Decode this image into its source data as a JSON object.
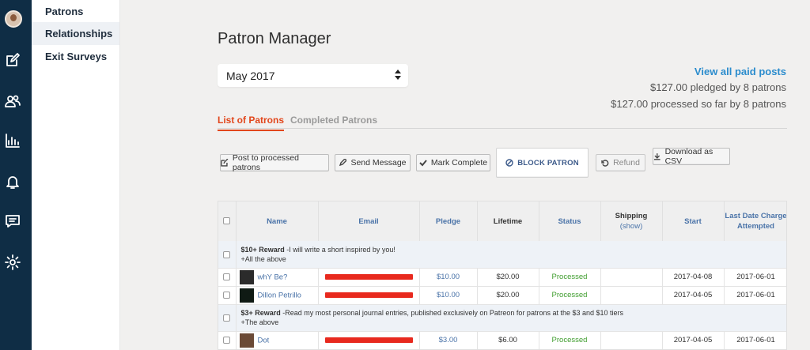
{
  "subnav": {
    "items": [
      {
        "label": "Patrons"
      },
      {
        "label": "Relationships"
      },
      {
        "label": "Exit Surveys"
      }
    ]
  },
  "page": {
    "title": "Patron Manager",
    "month_select": {
      "value": "May 2017"
    }
  },
  "summary": {
    "link": "View all paid posts",
    "pledged": "$127.00 pledged by 8 patrons",
    "processed": "$127.00 processed so far by 8 patrons"
  },
  "tabs": [
    {
      "label": "List of Patrons"
    },
    {
      "label": "Completed Patrons"
    }
  ],
  "toolbar": {
    "post": "Post to processed patrons",
    "send": "Send Message",
    "mark": "Mark Complete",
    "block": "BLOCK PATRON",
    "refund": "Refund",
    "download": "Download as CSV"
  },
  "table": {
    "headers": {
      "name": "Name",
      "email": "Email",
      "pledge": "Pledge",
      "lifetime": "Lifetime",
      "status": "Status",
      "shipping": "Shipping",
      "shipping_sub": "(show)",
      "start": "Start",
      "last_date": "Last Date Charge Attempted"
    },
    "groups": [
      {
        "reward": "$10+ Reward",
        "description": " -I will write a short inspired by you!",
        "extra": "+All the above",
        "rows": [
          {
            "name": "whY Be?",
            "pledge": "$10.00",
            "lifetime": "$20.00",
            "status": "Processed",
            "shipping": "",
            "start": "2017-04-08",
            "last": "2017-06-01"
          },
          {
            "name": "Dillon Petrillo",
            "pledge": "$10.00",
            "lifetime": "$20.00",
            "status": "Processed",
            "shipping": "",
            "start": "2017-04-05",
            "last": "2017-06-01"
          }
        ]
      },
      {
        "reward": "$3+ Reward",
        "description": " -Read my most personal journal entries, published exclusively on Patreon for patrons at the $3 and $10 tiers",
        "extra": "+The above",
        "rows": [
          {
            "name": "Dot",
            "pledge": "$3.00",
            "lifetime": "$6.00",
            "status": "Processed",
            "shipping": "",
            "start": "2017-04-05",
            "last": "2017-06-01"
          }
        ]
      }
    ]
  }
}
